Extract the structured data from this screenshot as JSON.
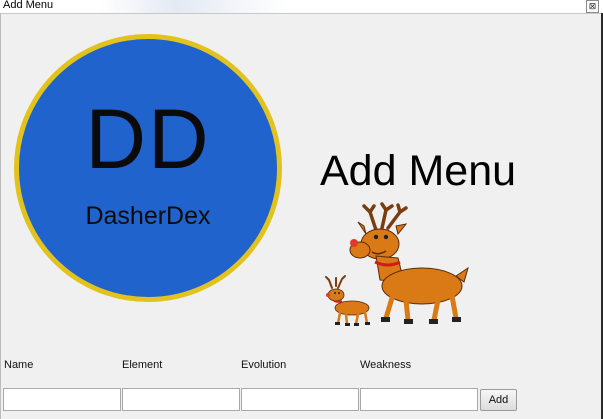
{
  "window": {
    "title": "Add Menu",
    "close_glyph": "⊠"
  },
  "logo": {
    "mark": "DD",
    "name": "DasherDex"
  },
  "heading": "Add Menu",
  "form": {
    "fields": [
      {
        "label": "Name",
        "value": ""
      },
      {
        "label": "Element",
        "value": ""
      },
      {
        "label": "Evolution",
        "value": ""
      },
      {
        "label": "Weakness",
        "value": ""
      }
    ],
    "add_label": "Add"
  },
  "colors": {
    "logo_fill": "#2163cc",
    "logo_ring": "#e2c21d",
    "reindeer_body": "#d97a16",
    "antlers": "#7a3d10",
    "nose": "#e23a2a",
    "collar": "#d21a1a"
  },
  "icons": {
    "illustration": "reindeer-illustration"
  }
}
